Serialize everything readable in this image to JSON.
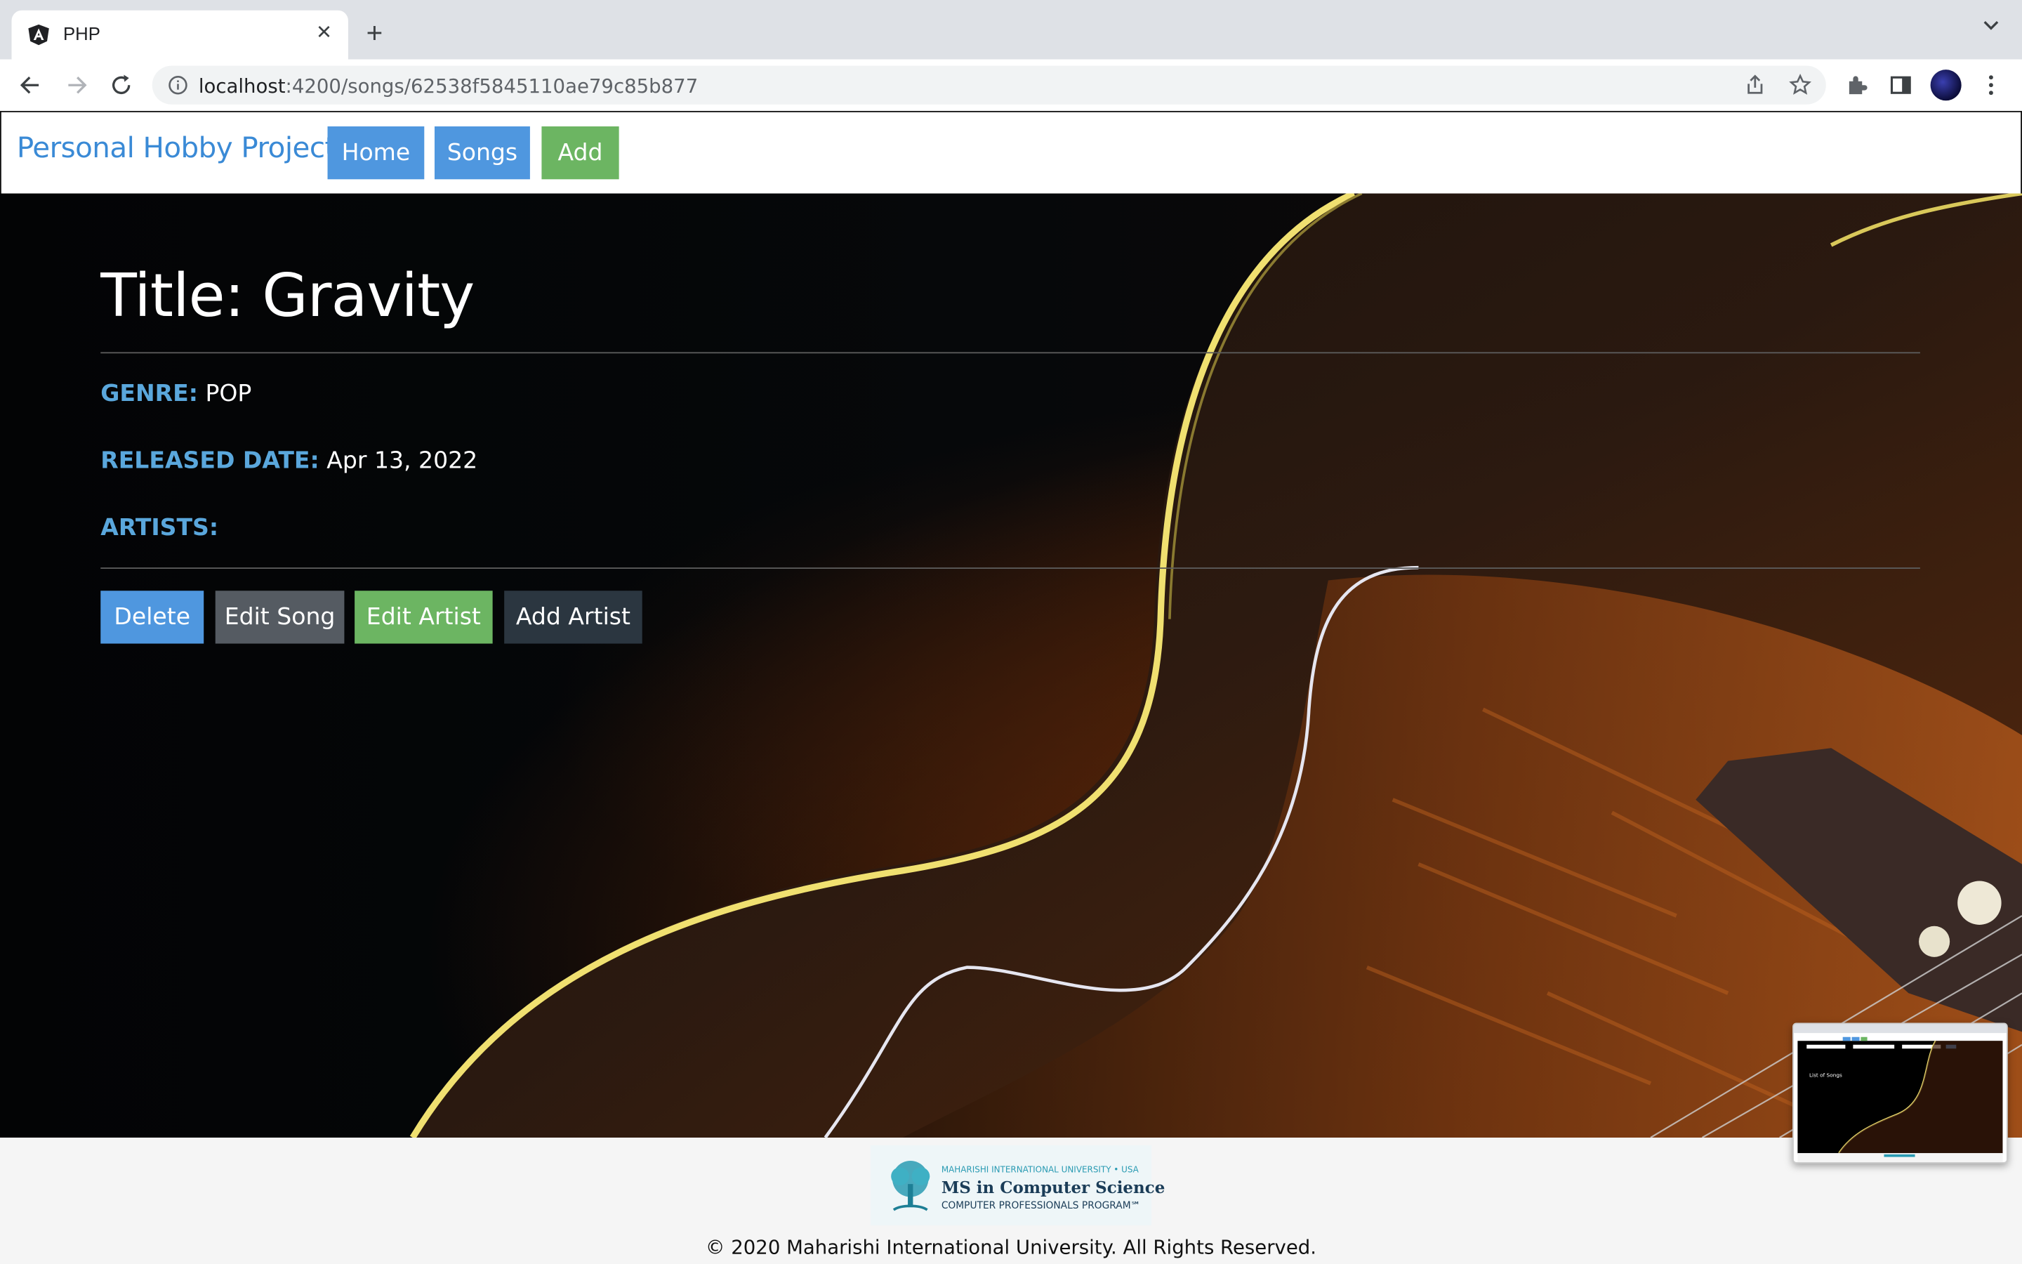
{
  "browser": {
    "tab_title": "PHP",
    "url_host": "localhost",
    "url_rest": ":4200/songs/62538f5845110ae79c85b877"
  },
  "app": {
    "brand": "Personal Hobby Project",
    "nav": [
      {
        "label": "Home",
        "color": "#4f97df"
      },
      {
        "label": "Songs",
        "color": "#4f97df"
      },
      {
        "label": "Add",
        "color": "#6cb562"
      }
    ]
  },
  "song": {
    "title": "Title: Gravity",
    "genre_label": "GENRE:",
    "genre_value": "POP",
    "released_label": "RELEASED DATE:",
    "released_value": "Apr 13, 2022",
    "artists_label": "ARTISTS:"
  },
  "actions": [
    {
      "label": "Delete",
      "color": "#4f97df"
    },
    {
      "label": "Edit Song",
      "color": "#555b62"
    },
    {
      "label": "Edit Artist",
      "color": "#6cb562"
    },
    {
      "label": "Add Artist",
      "color": "#2b3640"
    }
  ],
  "footer": {
    "logo_line1": "MAHARISHI INTERNATIONAL UNIVERSITY • USA",
    "logo_line2": "MS in Computer Science",
    "logo_line3": "COMPUTER PROFESSIONALS PROGRAM℠",
    "copyright": "© 2020 Maharishi International University. All Rights Reserved."
  },
  "pip": {
    "heading": "List of Songs"
  }
}
